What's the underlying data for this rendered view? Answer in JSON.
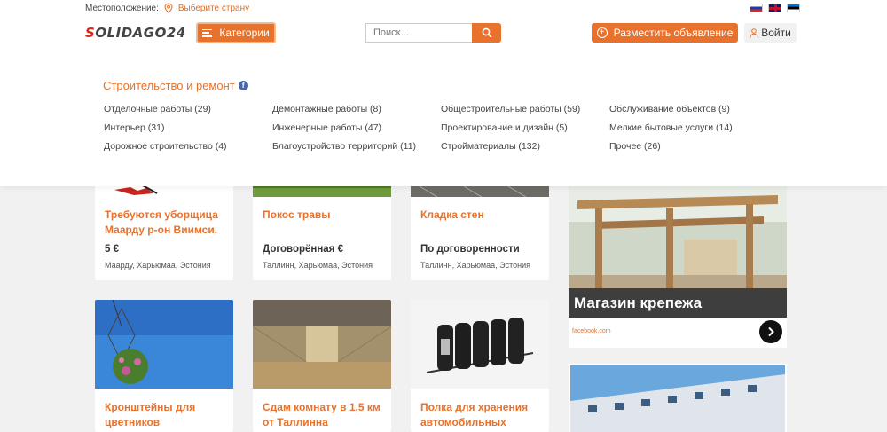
{
  "header": {
    "location_label": "Местоположение:",
    "country_placeholder": "Выберите страну",
    "logo_text": "Solidago24",
    "categories_label": "Категории",
    "search_placeholder": "Поиск...",
    "post_label": "Разместить объявление",
    "login_label": "Войти",
    "flags": [
      "ru",
      "gb",
      "ee"
    ]
  },
  "dropdown": {
    "section_title": "Строительство и ремонт",
    "categories": [
      "Отделочные работы (29)",
      "Демонтажные работы (8)",
      "Общестроительные работы (59)",
      "Обслуживание объектов (9)",
      "Интерьер (31)",
      "Инженерные работы (47)",
      "Проектирование и дизайн (5)",
      "Мелкие бытовые услуги (14)",
      "Дорожное строительство (4)",
      "Благоустройство территорий (11)",
      "Стройматериалы (132)",
      "Прочее (26)"
    ]
  },
  "listings": [
    {
      "title": "Требуются уборщица Маарду р-он Виимси.",
      "price": "5 €",
      "place": "Маарду, Харьюмаа, Эстония"
    },
    {
      "title": "Покос травы",
      "price": "Договорённая €",
      "place": "Таллинн, Харьюмаа, Эстония"
    },
    {
      "title": "Кладка стен",
      "price": "По договоренности",
      "place": "Таллинн, Харьюмаа, Эстония"
    },
    {
      "title": "Кронштейны для цветников",
      "price": "",
      "place": ""
    },
    {
      "title": "Сдам комнату в 1,5 км от Таллинна",
      "price": "",
      "place": ""
    },
    {
      "title": "Полка для хранения автомобильных",
      "price": "",
      "place": ""
    }
  ],
  "banner": {
    "title": "Магазин крепежа",
    "source": "facebook.com"
  },
  "colors": {
    "accent": "#e8722c",
    "text": "#333333"
  }
}
